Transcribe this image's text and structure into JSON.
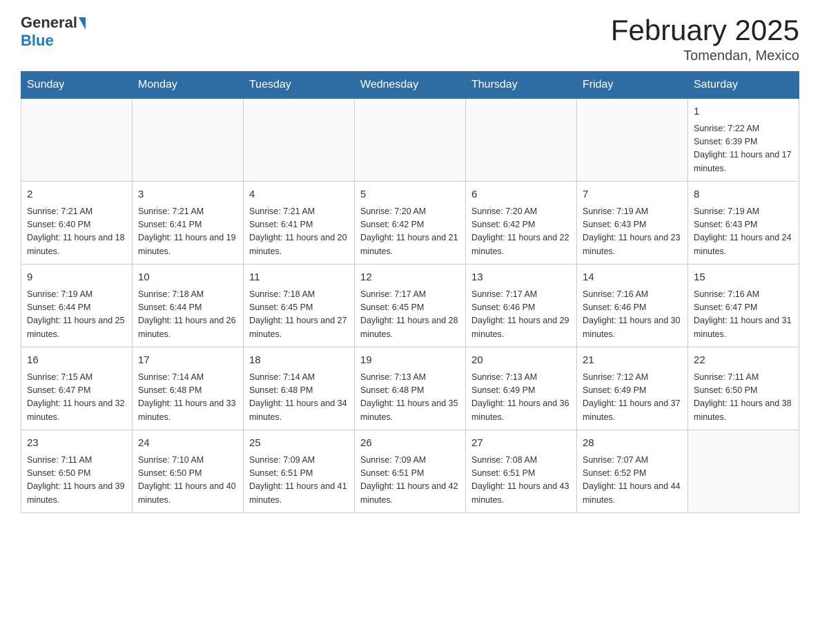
{
  "logo": {
    "general": "General",
    "blue": "Blue"
  },
  "header": {
    "month": "February 2025",
    "location": "Tomendan, Mexico"
  },
  "weekdays": [
    "Sunday",
    "Monday",
    "Tuesday",
    "Wednesday",
    "Thursday",
    "Friday",
    "Saturday"
  ],
  "weeks": [
    [
      {
        "day": "",
        "info": ""
      },
      {
        "day": "",
        "info": ""
      },
      {
        "day": "",
        "info": ""
      },
      {
        "day": "",
        "info": ""
      },
      {
        "day": "",
        "info": ""
      },
      {
        "day": "",
        "info": ""
      },
      {
        "day": "1",
        "info": "Sunrise: 7:22 AM\nSunset: 6:39 PM\nDaylight: 11 hours and 17 minutes."
      }
    ],
    [
      {
        "day": "2",
        "info": "Sunrise: 7:21 AM\nSunset: 6:40 PM\nDaylight: 11 hours and 18 minutes."
      },
      {
        "day": "3",
        "info": "Sunrise: 7:21 AM\nSunset: 6:41 PM\nDaylight: 11 hours and 19 minutes."
      },
      {
        "day": "4",
        "info": "Sunrise: 7:21 AM\nSunset: 6:41 PM\nDaylight: 11 hours and 20 minutes."
      },
      {
        "day": "5",
        "info": "Sunrise: 7:20 AM\nSunset: 6:42 PM\nDaylight: 11 hours and 21 minutes."
      },
      {
        "day": "6",
        "info": "Sunrise: 7:20 AM\nSunset: 6:42 PM\nDaylight: 11 hours and 22 minutes."
      },
      {
        "day": "7",
        "info": "Sunrise: 7:19 AM\nSunset: 6:43 PM\nDaylight: 11 hours and 23 minutes."
      },
      {
        "day": "8",
        "info": "Sunrise: 7:19 AM\nSunset: 6:43 PM\nDaylight: 11 hours and 24 minutes."
      }
    ],
    [
      {
        "day": "9",
        "info": "Sunrise: 7:19 AM\nSunset: 6:44 PM\nDaylight: 11 hours and 25 minutes."
      },
      {
        "day": "10",
        "info": "Sunrise: 7:18 AM\nSunset: 6:44 PM\nDaylight: 11 hours and 26 minutes."
      },
      {
        "day": "11",
        "info": "Sunrise: 7:18 AM\nSunset: 6:45 PM\nDaylight: 11 hours and 27 minutes."
      },
      {
        "day": "12",
        "info": "Sunrise: 7:17 AM\nSunset: 6:45 PM\nDaylight: 11 hours and 28 minutes."
      },
      {
        "day": "13",
        "info": "Sunrise: 7:17 AM\nSunset: 6:46 PM\nDaylight: 11 hours and 29 minutes."
      },
      {
        "day": "14",
        "info": "Sunrise: 7:16 AM\nSunset: 6:46 PM\nDaylight: 11 hours and 30 minutes."
      },
      {
        "day": "15",
        "info": "Sunrise: 7:16 AM\nSunset: 6:47 PM\nDaylight: 11 hours and 31 minutes."
      }
    ],
    [
      {
        "day": "16",
        "info": "Sunrise: 7:15 AM\nSunset: 6:47 PM\nDaylight: 11 hours and 32 minutes."
      },
      {
        "day": "17",
        "info": "Sunrise: 7:14 AM\nSunset: 6:48 PM\nDaylight: 11 hours and 33 minutes."
      },
      {
        "day": "18",
        "info": "Sunrise: 7:14 AM\nSunset: 6:48 PM\nDaylight: 11 hours and 34 minutes."
      },
      {
        "day": "19",
        "info": "Sunrise: 7:13 AM\nSunset: 6:48 PM\nDaylight: 11 hours and 35 minutes."
      },
      {
        "day": "20",
        "info": "Sunrise: 7:13 AM\nSunset: 6:49 PM\nDaylight: 11 hours and 36 minutes."
      },
      {
        "day": "21",
        "info": "Sunrise: 7:12 AM\nSunset: 6:49 PM\nDaylight: 11 hours and 37 minutes."
      },
      {
        "day": "22",
        "info": "Sunrise: 7:11 AM\nSunset: 6:50 PM\nDaylight: 11 hours and 38 minutes."
      }
    ],
    [
      {
        "day": "23",
        "info": "Sunrise: 7:11 AM\nSunset: 6:50 PM\nDaylight: 11 hours and 39 minutes."
      },
      {
        "day": "24",
        "info": "Sunrise: 7:10 AM\nSunset: 6:50 PM\nDaylight: 11 hours and 40 minutes."
      },
      {
        "day": "25",
        "info": "Sunrise: 7:09 AM\nSunset: 6:51 PM\nDaylight: 11 hours and 41 minutes."
      },
      {
        "day": "26",
        "info": "Sunrise: 7:09 AM\nSunset: 6:51 PM\nDaylight: 11 hours and 42 minutes."
      },
      {
        "day": "27",
        "info": "Sunrise: 7:08 AM\nSunset: 6:51 PM\nDaylight: 11 hours and 43 minutes."
      },
      {
        "day": "28",
        "info": "Sunrise: 7:07 AM\nSunset: 6:52 PM\nDaylight: 11 hours and 44 minutes."
      },
      {
        "day": "",
        "info": ""
      }
    ]
  ]
}
